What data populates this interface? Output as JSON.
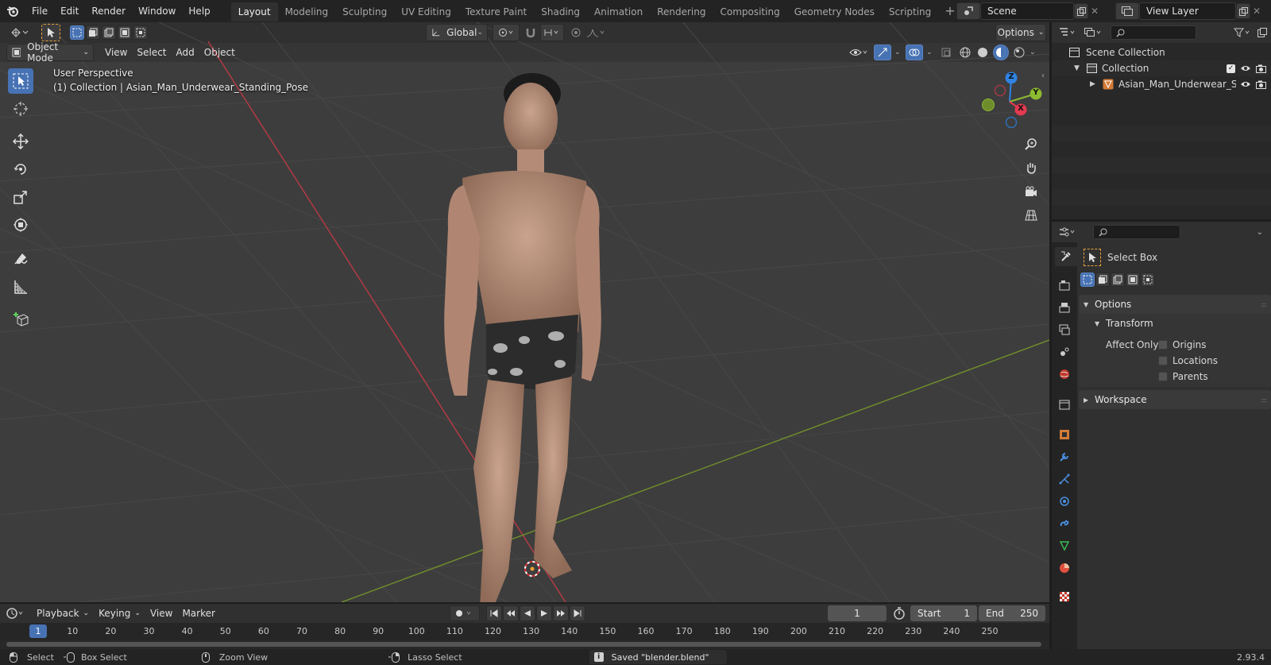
{
  "topbar": {
    "menus": [
      "File",
      "Edit",
      "Render",
      "Window",
      "Help"
    ],
    "workspaces": [
      "Layout",
      "Modeling",
      "Sculpting",
      "UV Editing",
      "Texture Paint",
      "Shading",
      "Animation",
      "Rendering",
      "Compositing",
      "Geometry Nodes",
      "Scripting"
    ],
    "active_workspace": "Layout",
    "scene_name": "Scene",
    "view_layer_name": "View Layer"
  },
  "tool_header": {
    "transform_orientation": "Global",
    "options_label": "Options"
  },
  "viewport_header": {
    "mode_label": "Object Mode",
    "menus": [
      "View",
      "Select",
      "Add",
      "Object"
    ]
  },
  "viewport": {
    "perspective_label": "User Perspective",
    "collection_label": "(1) Collection | Asian_Man_Underwear_Standing_Pose"
  },
  "gizmo": {
    "x_label": "X",
    "y_label": "Y",
    "z_label": "Z",
    "colors": {
      "x": "#e23a50",
      "y": "#8cba31",
      "z": "#2f83e3"
    }
  },
  "outliner": {
    "scene_collection": "Scene Collection",
    "collection": "Collection",
    "object": "Asian_Man_Underwear_S"
  },
  "properties": {
    "active_tool": "Select Box",
    "options_panel": "Options",
    "transform_subpanel": "Transform",
    "affect_only_label": "Affect Only",
    "checkboxes": [
      "Origins",
      "Locations",
      "Parents"
    ],
    "workspace_panel": "Workspace"
  },
  "timeline": {
    "menus": [
      "Playback",
      "Keying",
      "View",
      "Marker"
    ],
    "current_frame": "1",
    "start_label": "Start",
    "start_value": "1",
    "end_label": "End",
    "end_value": "250",
    "ticks": [
      "1",
      "10",
      "20",
      "30",
      "40",
      "50",
      "60",
      "70",
      "80",
      "90",
      "100",
      "110",
      "120",
      "130",
      "140",
      "150",
      "160",
      "170",
      "180",
      "190",
      "200",
      "210",
      "220",
      "230",
      "240",
      "250"
    ]
  },
  "statusbar": {
    "hint_select": "Select",
    "hint_box_select": "Box Select",
    "hint_zoom_view": "Zoom View",
    "hint_lasso_select": "Lasso Select",
    "message": "Saved \"blender.blend\"",
    "version": "2.93.4"
  },
  "colors": {
    "accent": "#4772b3",
    "x_axis_line": "#b33a44",
    "y_axis_line": "#6e8c2c"
  }
}
